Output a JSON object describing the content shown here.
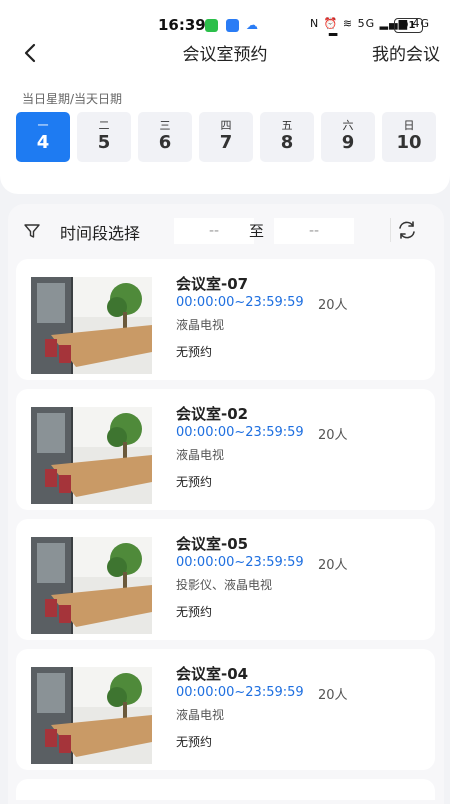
{
  "status_bar": {
    "time": "16:39",
    "indicators": "N ⏰ ≋ 5G ▂▄▆ 4G ▂▄▆",
    "battery": "91"
  },
  "header": {
    "title": "会议室预约",
    "right_link": "我的会议"
  },
  "date_section": {
    "label": "当日星期/当天日期",
    "days": [
      {
        "weekday": "一",
        "date": "4",
        "active": true
      },
      {
        "weekday": "二",
        "date": "5",
        "active": false
      },
      {
        "weekday": "三",
        "date": "6",
        "active": false
      },
      {
        "weekday": "四",
        "date": "7",
        "active": false
      },
      {
        "weekday": "五",
        "date": "8",
        "active": false
      },
      {
        "weekday": "六",
        "date": "9",
        "active": false
      },
      {
        "weekday": "日",
        "date": "10",
        "active": false
      }
    ]
  },
  "filter": {
    "label": "时间段选择",
    "start": "--",
    "separator": "至",
    "end": "--"
  },
  "rooms": [
    {
      "name": "会议室-07",
      "time": "00:00:00~23:59:59",
      "capacity": "20人",
      "equipment": "液晶电视",
      "status": "无预约"
    },
    {
      "name": "会议室-02",
      "time": "00:00:00~23:59:59",
      "capacity": "20人",
      "equipment": "液晶电视",
      "status": "无预约"
    },
    {
      "name": "会议室-05",
      "time": "00:00:00~23:59:59",
      "capacity": "20人",
      "equipment": "投影仪、液晶电视",
      "status": "无预约"
    },
    {
      "name": "会议室-04",
      "time": "00:00:00~23:59:59",
      "capacity": "20人",
      "equipment": "液晶电视",
      "status": "无预约"
    }
  ],
  "colors": {
    "accent": "#1e7bf2",
    "time_text": "#1e6fe0",
    "background": "#f2f3f6"
  }
}
